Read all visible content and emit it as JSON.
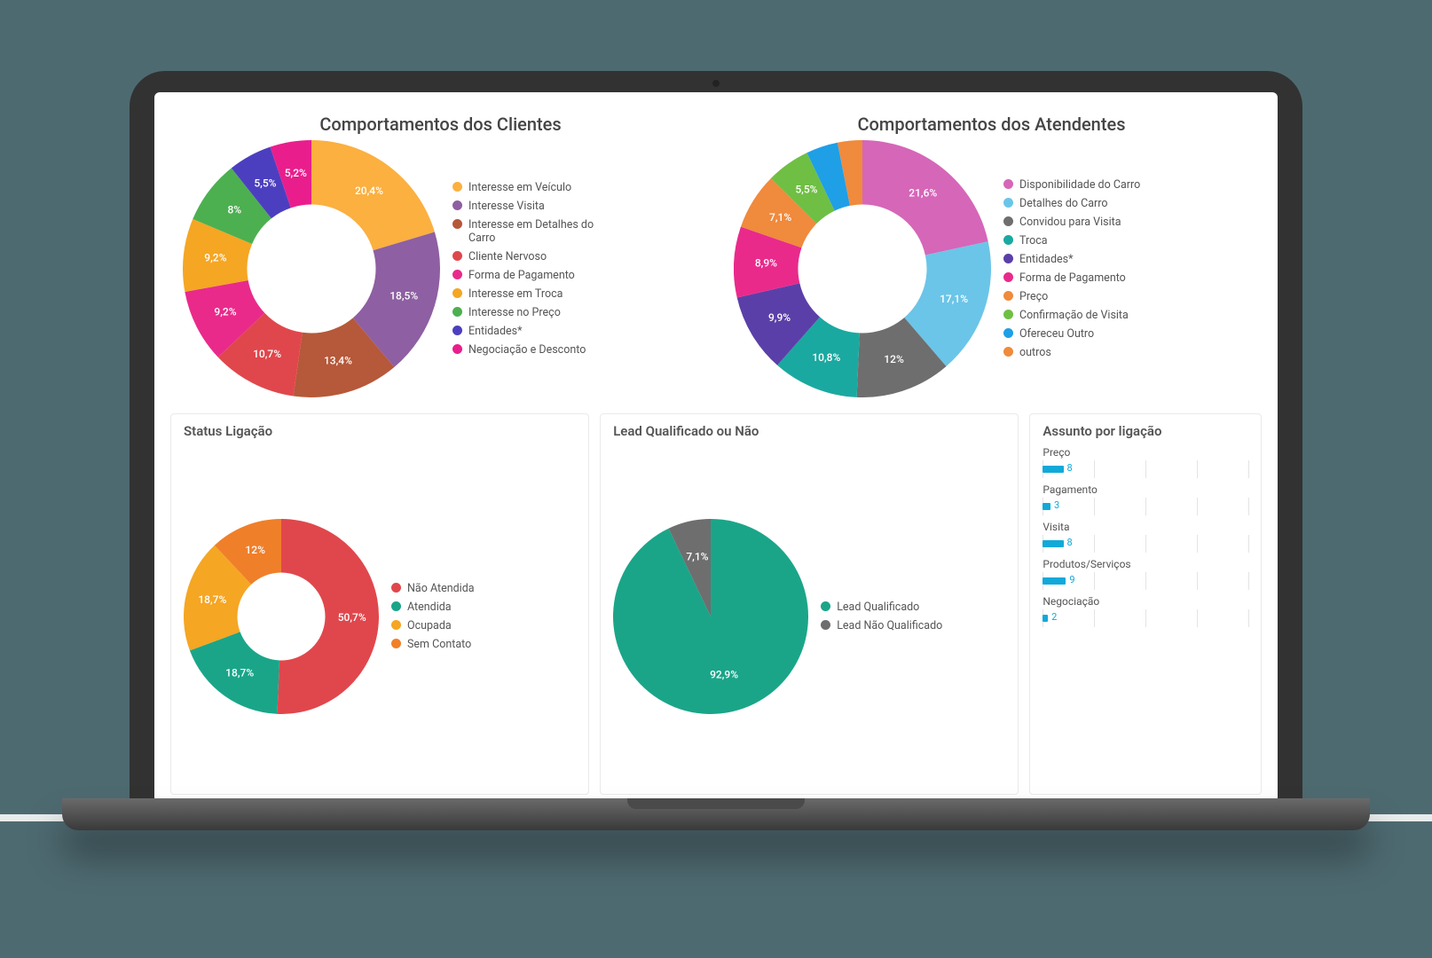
{
  "chart_data": [
    {
      "id": "clientes",
      "type": "donut",
      "title": "Comportamentos dos Clientes",
      "inner_ratio": 0.5,
      "series": [
        {
          "name": "Interesse em Veículo",
          "value": 20.4,
          "color": "#fbb040"
        },
        {
          "name": "Interesse Visita",
          "value": 18.5,
          "color": "#8e5fa2"
        },
        {
          "name": "Interesse em Detalhes do Carro",
          "value": 13.4,
          "color": "#b6583a"
        },
        {
          "name": "Cliente Nervoso",
          "value": 10.7,
          "color": "#e0474c"
        },
        {
          "name": "Forma de Pagamento",
          "value": 9.2,
          "color": "#e92a8b"
        },
        {
          "name": "Interesse em Troca",
          "value": 9.2,
          "color": "#f5a623"
        },
        {
          "name": "Interesse no Preço",
          "value": 8.0,
          "color": "#4cb050"
        },
        {
          "name": "Entidades*",
          "value": 5.5,
          "color": "#4c3fbf"
        },
        {
          "name": "Negociação e Desconto",
          "value": 5.2,
          "color": "#e91e8c"
        }
      ]
    },
    {
      "id": "atendentes",
      "type": "donut",
      "title": "Comportamentos dos Atendentes",
      "inner_ratio": 0.5,
      "series": [
        {
          "name": "Disponibilidade do Carro",
          "value": 21.6,
          "color": "#d666b8"
        },
        {
          "name": "Detalhes do Carro",
          "value": 17.1,
          "color": "#6bc5e8"
        },
        {
          "name": "Convidou para Visita",
          "value": 12.0,
          "color": "#6e6e6e"
        },
        {
          "name": "Troca",
          "value": 10.8,
          "color": "#1aa9a0"
        },
        {
          "name": "Entidades*",
          "value": 9.9,
          "color": "#5b3fa8"
        },
        {
          "name": "Forma de Pagamento",
          "value": 8.9,
          "color": "#e92a8b"
        },
        {
          "name": "Preço",
          "value": 7.1,
          "color": "#f08a3c"
        },
        {
          "name": "Confirmação de Visita",
          "value": 5.5,
          "color": "#6fbf44"
        },
        {
          "name": "Ofereceu Outro",
          "value": 4.0,
          "color": "#1f9fe6",
          "hide_label": true
        },
        {
          "name": "outros",
          "value": 3.1,
          "color": "#f08a3c",
          "hide_label": true
        }
      ]
    },
    {
      "id": "status",
      "type": "donut",
      "title": "Status Ligação",
      "inner_ratio": 0.45,
      "series": [
        {
          "name": "Não Atendida",
          "value": 50.7,
          "color": "#e0474c"
        },
        {
          "name": "Atendida",
          "value": 18.7,
          "color": "#1aa589"
        },
        {
          "name": "Ocupada",
          "value": 18.7,
          "color": "#f5a623"
        },
        {
          "name": "Sem Contato",
          "value": 12.0,
          "color": "#f07f2a"
        }
      ]
    },
    {
      "id": "lead",
      "type": "pie",
      "title": "Lead Qualificado ou Não",
      "inner_ratio": 0,
      "series": [
        {
          "name": "Lead Qualificado",
          "value": 92.9,
          "color": "#1aa589"
        },
        {
          "name": "Lead Não Qualificado",
          "value": 7.1,
          "color": "#6e6e6e"
        }
      ]
    },
    {
      "id": "assunto",
      "type": "bar",
      "title": "Assunto por ligação",
      "x_max": 80,
      "grid_ticks": [
        0,
        20,
        40,
        60,
        80
      ],
      "categories": [
        "Preço",
        "Pagamento",
        "Visita",
        "Produtos/Serviços",
        "Negociação"
      ],
      "values": [
        8,
        3,
        8,
        9,
        2
      ],
      "bar_color": "#11a9d9"
    }
  ]
}
